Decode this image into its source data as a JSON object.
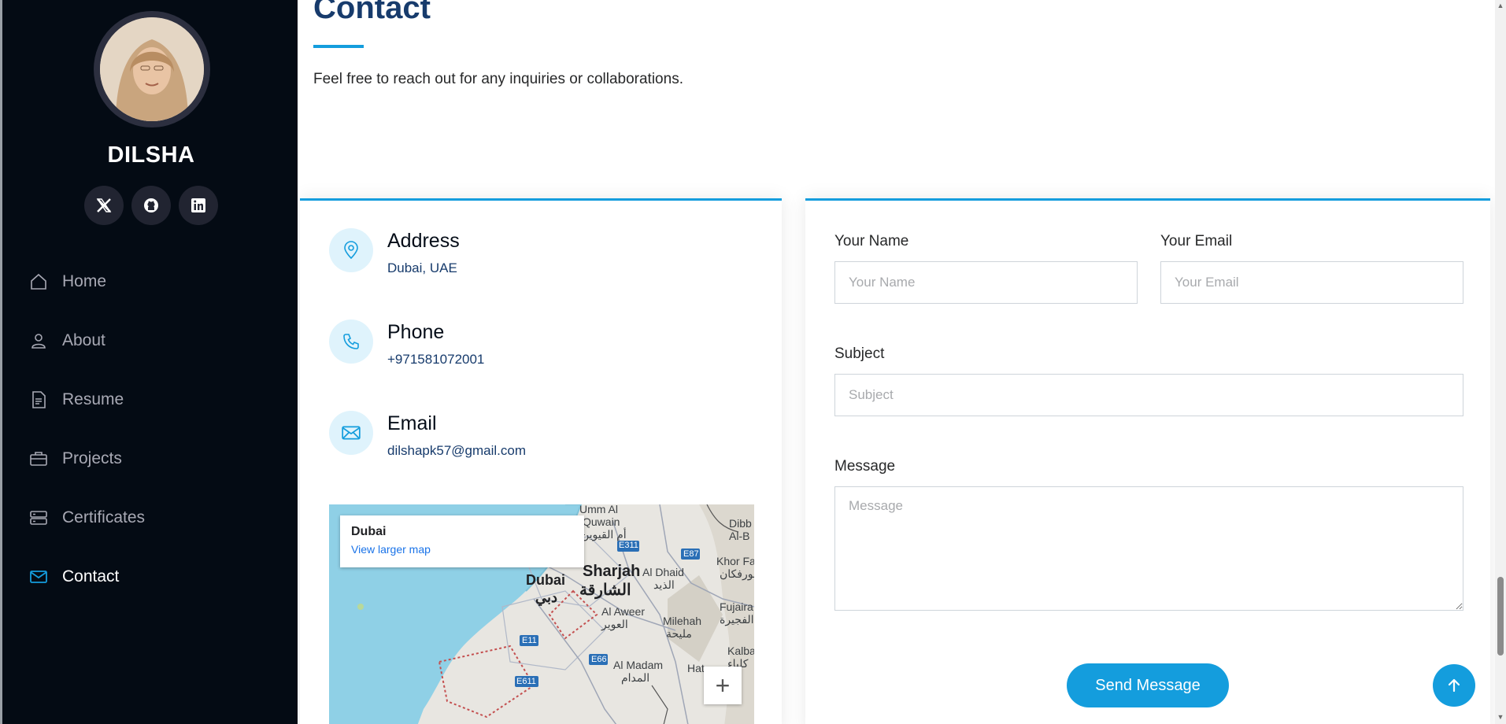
{
  "profile": {
    "name": "DILSHA",
    "socials": [
      {
        "icon": "x-twitter-icon"
      },
      {
        "icon": "github-icon"
      },
      {
        "icon": "linkedin-icon"
      }
    ]
  },
  "nav": {
    "items": [
      {
        "label": "Home",
        "icon": "house-icon"
      },
      {
        "label": "About",
        "icon": "person-icon"
      },
      {
        "label": "Resume",
        "icon": "file-text-icon"
      },
      {
        "label": "Projects",
        "icon": "briefcase-icon"
      },
      {
        "label": "Certificates",
        "icon": "server-icon"
      },
      {
        "label": "Contact",
        "icon": "envelope-icon",
        "active": true
      }
    ]
  },
  "section": {
    "title": "Contact",
    "intro": "Feel free to reach out for any inquiries or collaborations."
  },
  "info": {
    "address": {
      "label": "Address",
      "value": "Dubai, UAE",
      "icon": "map-pin-icon"
    },
    "phone": {
      "label": "Phone",
      "value": "+971581072001",
      "icon": "phone-icon"
    },
    "email": {
      "label": "Email",
      "value": "dilshapk57@gmail.com",
      "icon": "envelope-icon"
    }
  },
  "map": {
    "place": "Dubai",
    "link": "View larger map",
    "labels": {
      "dubai": "Dubai",
      "dubai_ar": "دبي",
      "sharjah": "Sharjah",
      "sharjah_ar": "الشارقة",
      "umm_al_quwain": "Umm Al",
      "umm_al_quwain2": "Quwain",
      "umm_al_quwain_ar": "أم القيوين",
      "al_dhaid": "Al Dhaid",
      "al_dhaid_ar": "الذيد",
      "al_aweer": "Al Aweer",
      "al_aweer_ar": "العوير",
      "milehah": "Milehah",
      "milehah_ar": "مليحة",
      "al_madam": "Al Madam",
      "al_madam_ar": "المدام",
      "khor_fakkan": "Khor Fak",
      "khor_fakkan_ar": "خورفكان",
      "fujairah": "Fujaira",
      "fujairah_ar": "الفجيرة",
      "dibba": "Dibb",
      "dibba2": "Al-B",
      "kalba": "Kalba",
      "kalba_ar": "كلباء",
      "hatta": "Hat",
      "e311": "E311",
      "e87": "E87",
      "e11": "E11",
      "e66": "E66",
      "e611": "E611"
    },
    "zoom_in": "+"
  },
  "form": {
    "name_label": "Your Name",
    "name_placeholder": "Your Name",
    "email_label": "Your Email",
    "email_placeholder": "Your Email",
    "subject_label": "Subject",
    "subject_placeholder": "Subject",
    "message_label": "Message",
    "message_placeholder": "Message",
    "submit_label": "Send Message"
  },
  "colors": {
    "accent": "#149ddd",
    "sidebar_bg": "#040b14",
    "title": "#173b6c"
  }
}
